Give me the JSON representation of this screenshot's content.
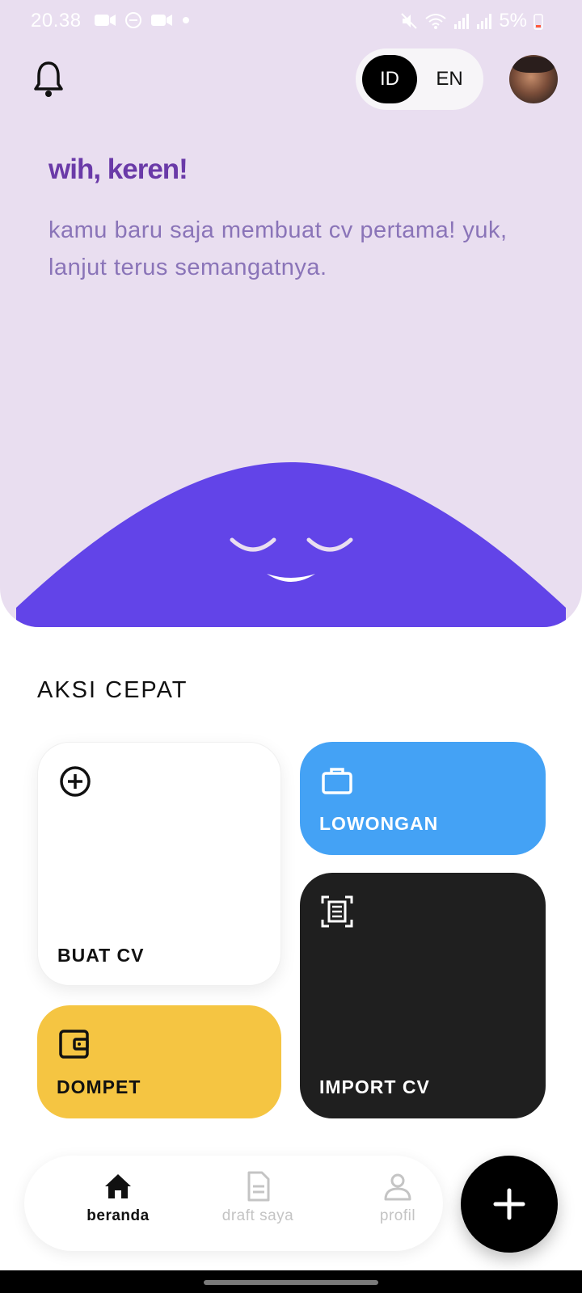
{
  "status_bar": {
    "time": "20.38",
    "battery": "5%",
    "icons": [
      "video-icon",
      "dnd-icon",
      "video-icon",
      "dot-icon",
      "mute-icon",
      "wifi-icon",
      "signal-icon",
      "signal-icon",
      "battery-icon"
    ]
  },
  "header": {
    "language_options": [
      "ID",
      "EN"
    ],
    "selected_language": "ID"
  },
  "greeting": {
    "title": "wih, keren!",
    "subtitle": "kamu baru saja membuat cv pertama! yuk, lanjut terus semangatnya."
  },
  "quick_actions": {
    "title": "AKSI CEPAT",
    "cards": [
      {
        "label": "BUAT CV",
        "icon": "add-circle-icon",
        "color": "#ffffff"
      },
      {
        "label": "LOWONGAN",
        "icon": "briefcase-icon",
        "color": "#44a2f5"
      },
      {
        "label": "IMPORT CV",
        "icon": "document-scan-icon",
        "color": "#1f1f1f"
      },
      {
        "label": "DOMPET",
        "icon": "wallet-icon",
        "color": "#f5c542"
      }
    ]
  },
  "bottom_nav": {
    "items": [
      {
        "label": "beranda",
        "icon": "home-icon",
        "active": true
      },
      {
        "label": "draft saya",
        "icon": "document-icon",
        "active": false
      },
      {
        "label": "profil",
        "icon": "person-icon",
        "active": false
      }
    ]
  },
  "colors": {
    "hero_background": "#e9def0",
    "accent_purple": "#6a3aa8",
    "blob_purple": "#6244e8"
  }
}
